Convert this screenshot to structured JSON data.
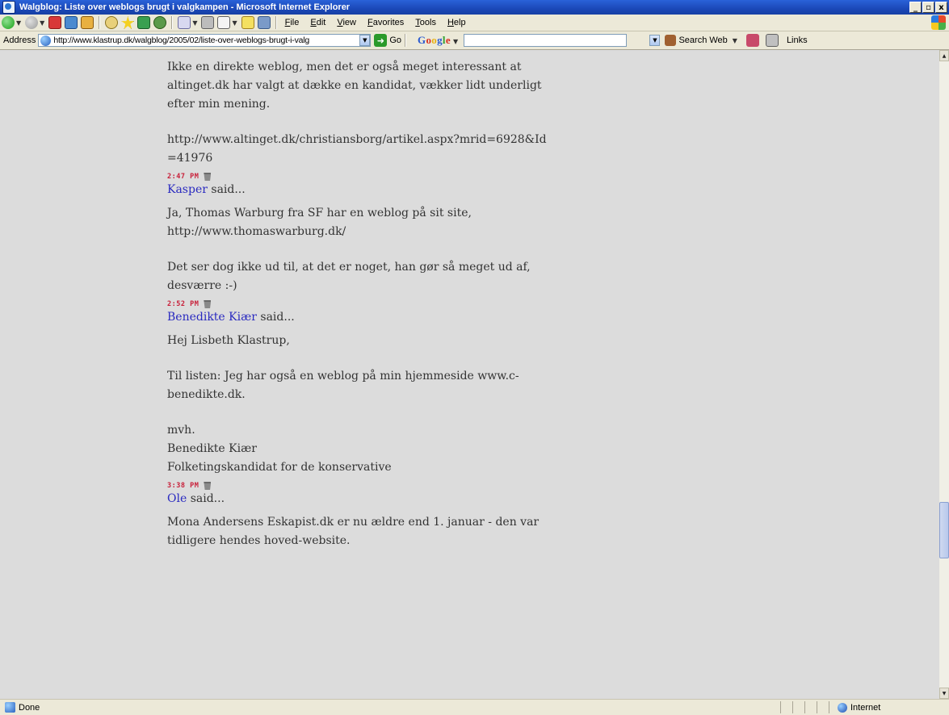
{
  "window": {
    "title": "Walgblog: Liste over weblogs brugt i valgkampen - Microsoft Internet Explorer",
    "minimize_glyph": "_",
    "maximize_glyph": "▫",
    "close_glyph": "x"
  },
  "menu": [
    "File",
    "Edit",
    "View",
    "Favorites",
    "Tools",
    "Help"
  ],
  "toolbar_icons": [
    "back-icon",
    "forward-icon",
    "stop-icon",
    "refresh-icon",
    "home-icon",
    "search-icon",
    "favorites-icon",
    "media-icon",
    "history-icon",
    "mail-icon",
    "print-icon",
    "edit-icon",
    "note-icon",
    "discuss-icon"
  ],
  "address": {
    "label": "Address",
    "url": "http://www.klastrup.dk/walgblog/2005/02/liste-over-weblogs-brugt-i-valg",
    "go_label": "Go"
  },
  "google_toolbar": {
    "search_web_label": "Search Web",
    "links_label": "Links"
  },
  "content": {
    "intro_comment": {
      "para1": "Ikke en direkte weblog, men det er også meget interessant at altinget.dk har valgt at dække en kandidat, vækker lidt underligt efter min mening.",
      "para2": "http://www.altinget.dk/christiansborg/artikel.aspx?mrid=6928&Id=41976",
      "time": "2:47 PM"
    },
    "comments": [
      {
        "author": "Kasper",
        "said": " said...",
        "paragraphs": [
          "Ja, Thomas Warburg fra SF har en weblog på sit site, http://www.thomaswarburg.dk/",
          "Det ser dog ikke ud til, at det er noget, han gør så meget ud af, desværre :-)"
        ],
        "time": "2:52 PM"
      },
      {
        "author": "Benedikte Kiær",
        "said": " said...",
        "paragraphs": [
          "Hej Lisbeth Klastrup,",
          "Til listen: Jeg har også en weblog på min hjemmeside www.c-benedikte.dk.",
          "mvh.",
          "Benedikte Kiær",
          "Folketingskandidat for de konservative"
        ],
        "time": "3:38 PM"
      },
      {
        "author": "Ole",
        "said": " said...",
        "paragraphs": [
          "Mona Andersens Eskapist.dk er nu ældre end 1. januar - den var tidligere hendes hoved-website."
        ],
        "time": ""
      }
    ]
  },
  "status": {
    "text": "Done",
    "zone": "Internet"
  }
}
